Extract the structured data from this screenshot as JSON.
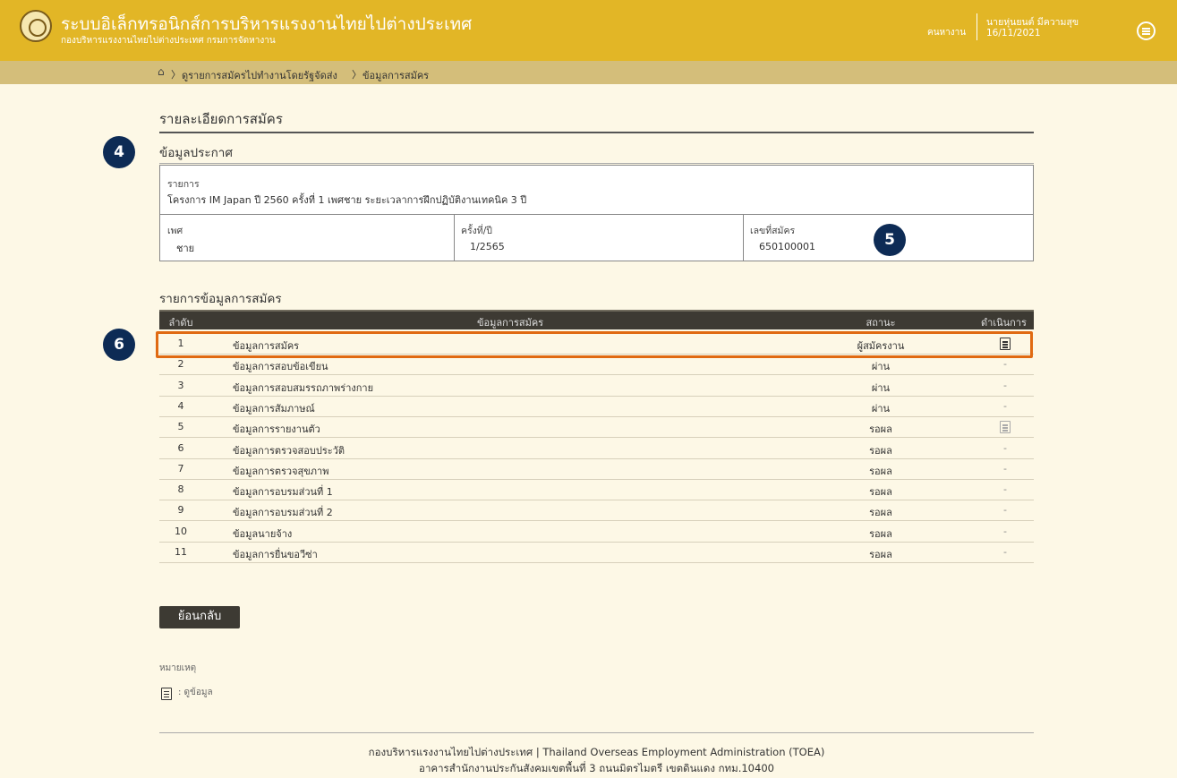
{
  "header": {
    "title": "ระบบอิเล็กทรอนิกส์การบริหารแรงงานไทยไปต่างประเทศ",
    "subtitle": "กองบริหารแรงงานไทยไปต่างประเทศ กรมการจัดหางาน",
    "role": "คนหางาน",
    "user_name": "นายหุ่นยนต์ มีความสุข",
    "date": "16/11/2021"
  },
  "breadcrumb": {
    "item1": "ดูรายการสมัครไปทำงานโดยรัฐจัดส่ง",
    "item2": "ข้อมูลการสมัคร"
  },
  "page_title": "รายละเอียดการสมัคร",
  "announcement": {
    "section_title": "ข้อมูลประกาศ",
    "item_label": "รายการ",
    "item_value": "โครงการ IM Japan ปี 2560 ครั้งที่ 1 เพศชาย ระยะเวลาการฝึกปฏิบัติงานเทคนิค 3 ปี",
    "gender_label": "เพศ",
    "gender_value": "ชาย",
    "round_label": "ครั้งที่/ปี",
    "round_value": "1/2565",
    "app_no_label": "เลขที่สมัคร",
    "app_no_value": "650100001"
  },
  "badges": {
    "b4": "4",
    "b5": "5",
    "b6": "6"
  },
  "table": {
    "section_title": "รายการข้อมูลการสมัคร",
    "headers": {
      "no": "ลำดับ",
      "info": "ข้อมูลการสมัคร",
      "status": "สถานะ",
      "action": "ดำเนินการ"
    },
    "rows": [
      {
        "no": "1",
        "title": "ข้อมูลการสมัคร",
        "status": "ผู้สมัครงาน",
        "action": "doc-icon"
      },
      {
        "no": "2",
        "title": "ข้อมูลการสอบข้อเขียน",
        "status": "ผ่าน",
        "action": "-"
      },
      {
        "no": "3",
        "title": "ข้อมูลการสอบสมรรถภาพร่างกาย",
        "status": "ผ่าน",
        "action": "-"
      },
      {
        "no": "4",
        "title": "ข้อมูลการสัมภาษณ์",
        "status": "ผ่าน",
        "action": "-"
      },
      {
        "no": "5",
        "title": "ข้อมูลการรายงานตัว",
        "status": "รอผล",
        "action": "doc-icon-disabled"
      },
      {
        "no": "6",
        "title": "ข้อมูลการตรวจสอบประวัติ",
        "status": "รอผล",
        "action": "-"
      },
      {
        "no": "7",
        "title": "ข้อมูลการตรวจสุขภาพ",
        "status": "รอผล",
        "action": "-"
      },
      {
        "no": "8",
        "title": "ข้อมูลการอบรมส่วนที่ 1",
        "status": "รอผล",
        "action": "-"
      },
      {
        "no": "9",
        "title": "ข้อมูลการอบรมส่วนที่ 2",
        "status": "รอผล",
        "action": "-"
      },
      {
        "no": "10",
        "title": "ข้อมูลนายจ้าง",
        "status": "รอผล",
        "action": "-"
      },
      {
        "no": "11",
        "title": "ข้อมูลการยื่นขอวีซ่า",
        "status": "รอผล",
        "action": "-"
      }
    ]
  },
  "back_button": "ย้อนกลับ",
  "note": {
    "label": "หมายเหตุ",
    "text": ": ดูข้อมูล"
  },
  "footer": {
    "line1": "กองบริหารแรงงานไทยไปต่างประเทศ | Thailand Overseas Employment Administration (TOEA)",
    "line2": "อาคารสำนักงานประกันสังคมเขตพื้นที่ 3 ถนนมิตรไมตรี เขตดินแดง กทม.10400"
  },
  "colors": {
    "header_bg": "#e2b626",
    "breadcrumb_bg": "#d4be7a",
    "page_bg": "#fdf8e6",
    "table_header_bg": "#3d3a33",
    "badge_bg": "#0d2b55",
    "highlight": "#e06a12"
  }
}
